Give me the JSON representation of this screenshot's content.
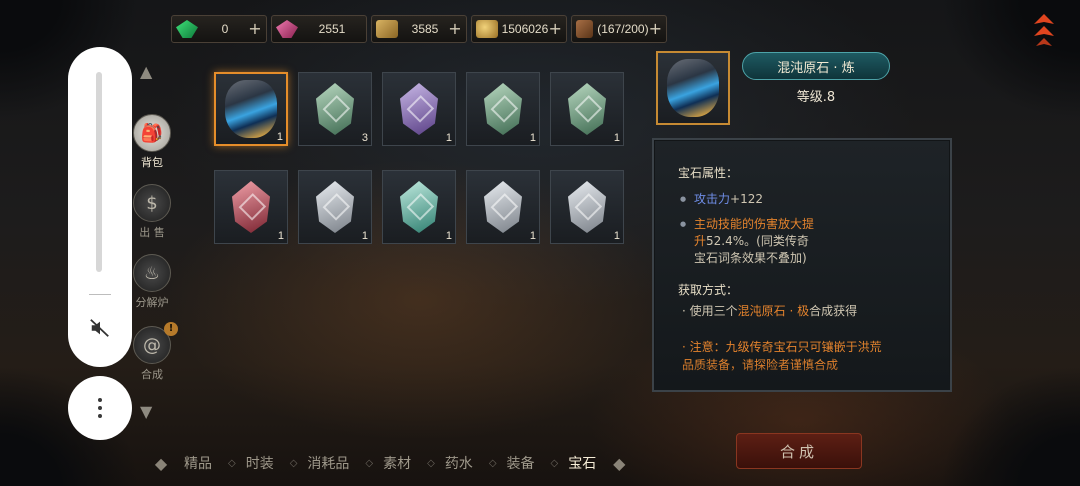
{
  "currency": [
    {
      "id": "emerald",
      "value": "0",
      "icon": "emerald-gem-icon"
    },
    {
      "id": "ruby",
      "value": "2551",
      "icon": "ruby-gem-icon"
    },
    {
      "id": "ticket",
      "value": "3585",
      "icon": "ticket-icon"
    },
    {
      "id": "gold",
      "value": "1506026",
      "icon": "gold-coin-bag-icon"
    },
    {
      "id": "bag",
      "value": "(167/200)",
      "icon": "inventory-bag-icon"
    }
  ],
  "side_nav": [
    {
      "label": "背包",
      "icon": "backpack-icon",
      "active": true
    },
    {
      "label": "出 售",
      "icon": "money-bag-icon",
      "active": false
    },
    {
      "label": "分解炉",
      "icon": "furnace-icon",
      "active": false
    },
    {
      "label": "合成",
      "icon": "swirl-icon",
      "active": false,
      "badge": "!"
    }
  ],
  "gems": [
    {
      "type": "chaos-stone",
      "qty": "1",
      "selected": true
    },
    {
      "type": "green",
      "qty": "3"
    },
    {
      "type": "purple",
      "qty": "1"
    },
    {
      "type": "green",
      "qty": "1"
    },
    {
      "type": "green",
      "qty": "1"
    },
    {
      "type": "red",
      "qty": "1"
    },
    {
      "type": "white",
      "qty": "1"
    },
    {
      "type": "teal",
      "qty": "1"
    },
    {
      "type": "white",
      "qty": "1"
    },
    {
      "type": "white",
      "qty": "1"
    }
  ],
  "detail": {
    "name": "混沌原石 · 炼",
    "level": "等级.8",
    "attr_title": "宝石属性：",
    "attr1_name": "攻击力",
    "attr1_value": "+122",
    "attr2_line1": "主动技能的伤害放大提",
    "attr2_pre": "升",
    "attr2_value": "52.4%",
    "attr2_post": "。(同类传奇",
    "attr2_line3": "宝石词条效果不叠加)",
    "obtain_title": "获取方式：",
    "obtain_pre": "使用三个",
    "obtain_item": "混沌原石 · 极",
    "obtain_post": "合成获得",
    "note_line1": "· 注意：九级传奇宝石只可镶嵌于洪荒",
    "note_line2": "品质装备，请探险者谨慎合成"
  },
  "synth_button": "合成",
  "tabs": [
    "精品",
    "时装",
    "消耗品",
    "素材",
    "药水",
    "装备",
    "宝石"
  ],
  "active_tab": "宝石",
  "colors": {
    "accent_orange": "#e58d2a",
    "attr_blue": "#6f8de6",
    "attr_orange": "#e4832d",
    "name_tag": "#1e5a62"
  }
}
